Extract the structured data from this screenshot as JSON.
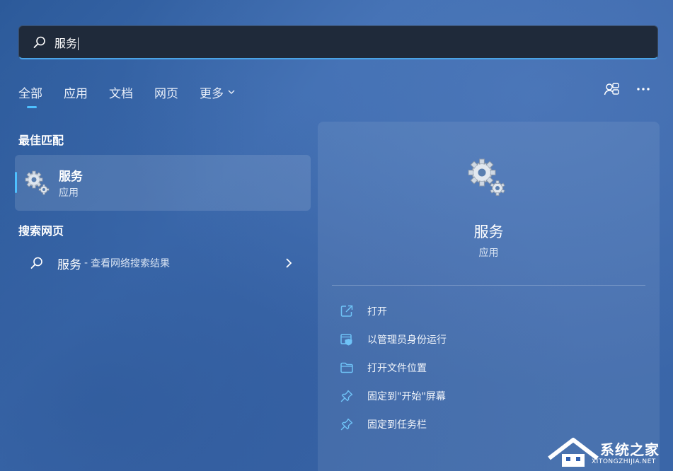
{
  "search": {
    "query": "服务"
  },
  "tabs": [
    {
      "label": "全部",
      "active": true
    },
    {
      "label": "应用",
      "active": false
    },
    {
      "label": "文档",
      "active": false
    },
    {
      "label": "网页",
      "active": false
    },
    {
      "label": "更多",
      "active": false
    }
  ],
  "best_match": {
    "section_title": "最佳匹配",
    "name": "服务",
    "type": "应用",
    "icon": "gears-icon"
  },
  "web_search": {
    "section_title": "搜索网页",
    "term": "服务",
    "separator": "-",
    "description": "查看网络搜索结果"
  },
  "detail": {
    "name": "服务",
    "type": "应用",
    "icon": "gears-icon",
    "actions": [
      {
        "label": "打开",
        "icon": "open-external-icon"
      },
      {
        "label": "以管理员身份运行",
        "icon": "run-as-admin-icon"
      },
      {
        "label": "打开文件位置",
        "icon": "folder-icon"
      },
      {
        "label": "固定到\"开始\"屏幕",
        "icon": "pin-icon"
      },
      {
        "label": "固定到任务栏",
        "icon": "pin-icon"
      }
    ]
  },
  "watermark": {
    "text": "系统之家",
    "subtext": "XITONGZHIJIA.NET"
  },
  "colors": {
    "accent": "#4ec0ff",
    "search_bar": "#1f2a3a",
    "background": "#3a66a8"
  }
}
